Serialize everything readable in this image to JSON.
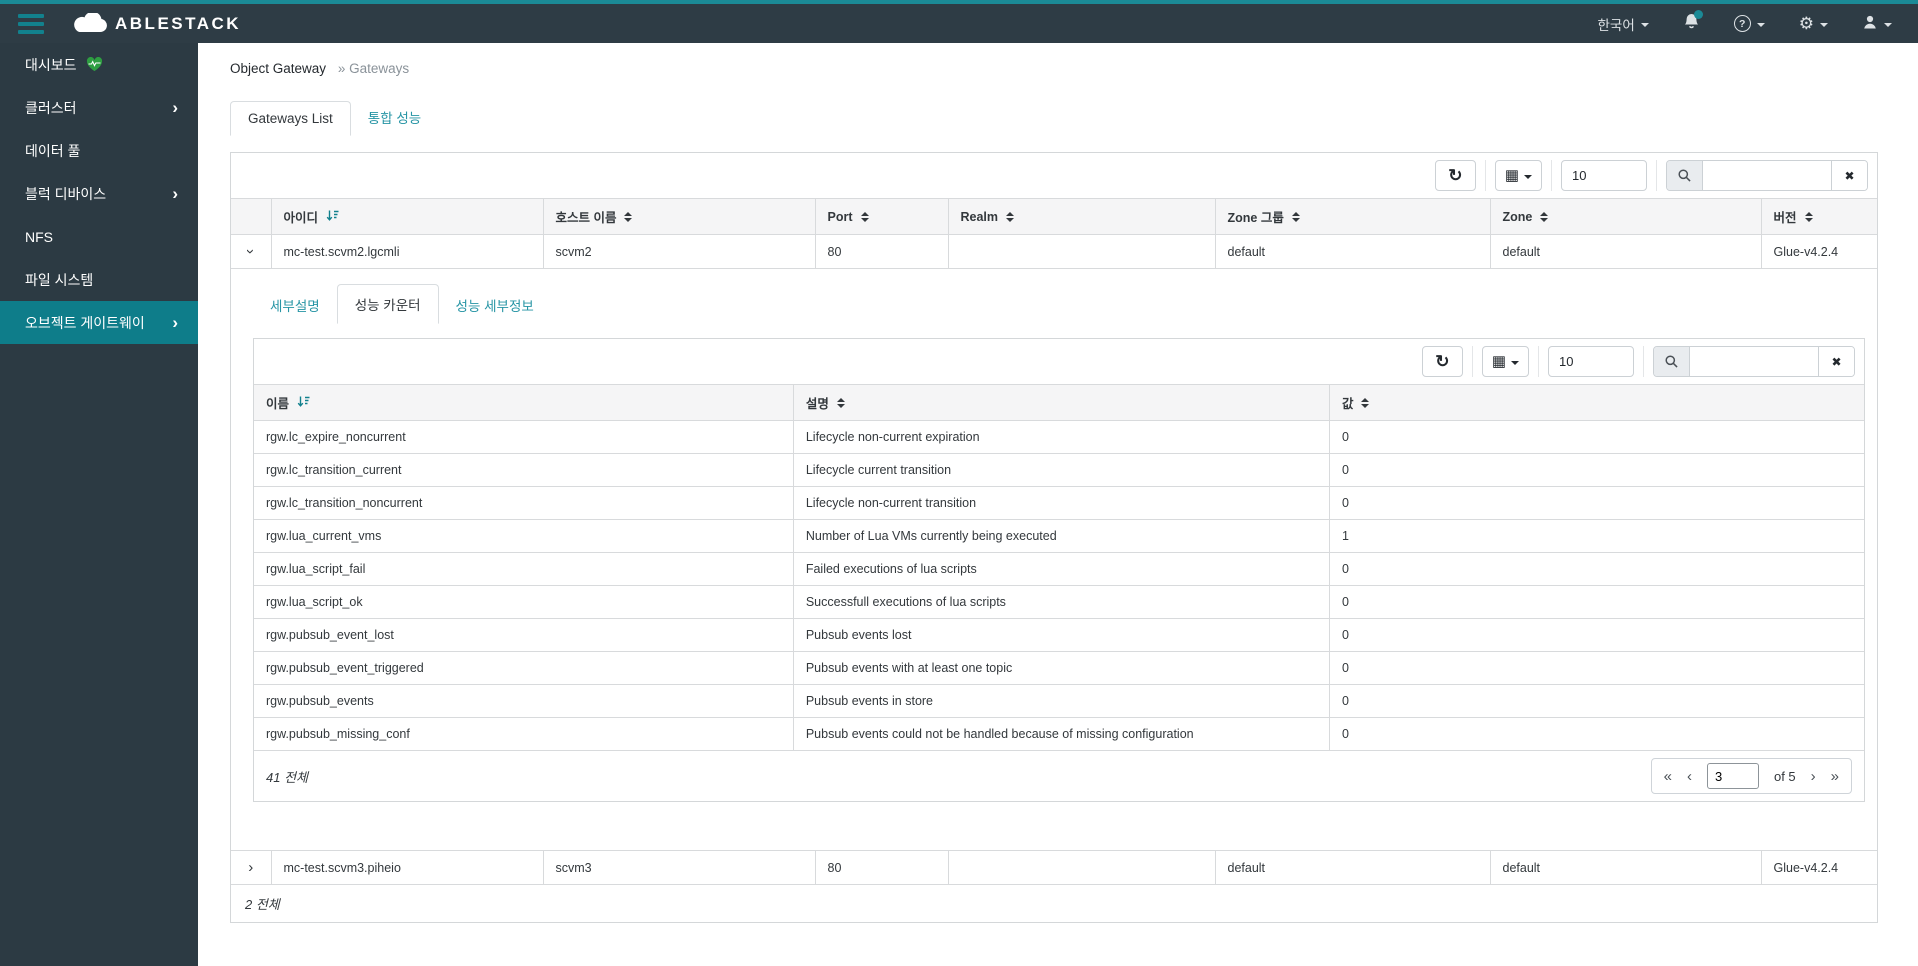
{
  "accent_colors": {
    "teal_strip": "#1b8a96",
    "active_nav": "#0e7d8a",
    "link_teal": "#2795a5",
    "sorted_header": "#11808d",
    "navbar_bg": "#2e3c45",
    "sidebar_bg": "#2c3a43"
  },
  "topbar": {
    "brand": "ABLESTACK",
    "language": "한국어",
    "help_glyph": "?"
  },
  "icons": {
    "refresh": "↻",
    "table_grid": "▦",
    "clear": "✖",
    "chevron": "›",
    "pg_first": "«",
    "pg_prev": "‹",
    "pg_next": "›",
    "pg_last": "»"
  },
  "sidebar": {
    "items": [
      {
        "label": "대시보드"
      },
      {
        "label": "클러스터"
      },
      {
        "label": "데이터 풀"
      },
      {
        "label": "블럭 디바이스"
      },
      {
        "label": "NFS"
      },
      {
        "label": "파일 시스템"
      },
      {
        "label": "오브젝트 게이트웨이"
      }
    ]
  },
  "breadcrumb": {
    "section": "Object Gateway",
    "rest": "» Gateways"
  },
  "tabs": {
    "gateways_list": "Gateways List",
    "overall_performance": "통합 성능"
  },
  "gateways_table": {
    "toolbar": {
      "page_size": "10",
      "search_value": ""
    },
    "columns": {
      "id": "아이디",
      "host": "호스트 이름",
      "port": "Port",
      "realm": "Realm",
      "zonegroup": "Zone 그룹",
      "zone": "Zone",
      "version": "버전"
    },
    "rows": [
      {
        "id": "mc-test.scvm2.lgcmli",
        "host": "scvm2",
        "port": "80",
        "realm": "",
        "zonegroup": "default",
        "zone": "default",
        "version": "Glue-v4.2.4"
      },
      {
        "id": "mc-test.scvm3.piheio",
        "host": "scvm3",
        "port": "80",
        "realm": "",
        "zonegroup": "default",
        "zone": "default",
        "version": "Glue-v4.2.4"
      }
    ],
    "footer_total": "2 전체"
  },
  "detail": {
    "tabs": {
      "details": "세부설명",
      "performance_counters": "성능 카운터",
      "performance_details": "성능 세부정보"
    },
    "counters_table": {
      "toolbar": {
        "page_size": "10",
        "search_value": ""
      },
      "columns": {
        "name": "이름",
        "description": "설명",
        "value": "값"
      },
      "rows": [
        {
          "name": "rgw.lc_expire_noncurrent",
          "description": "Lifecycle non-current expiration",
          "value": "0"
        },
        {
          "name": "rgw.lc_transition_current",
          "description": "Lifecycle current transition",
          "value": "0"
        },
        {
          "name": "rgw.lc_transition_noncurrent",
          "description": "Lifecycle non-current transition",
          "value": "0"
        },
        {
          "name": "rgw.lua_current_vms",
          "description": "Number of Lua VMs currently being executed",
          "value": "1"
        },
        {
          "name": "rgw.lua_script_fail",
          "description": "Failed executions of lua scripts",
          "value": "0"
        },
        {
          "name": "rgw.lua_script_ok",
          "description": "Successfull executions of lua scripts",
          "value": "0"
        },
        {
          "name": "rgw.pubsub_event_lost",
          "description": "Pubsub events lost",
          "value": "0"
        },
        {
          "name": "rgw.pubsub_event_triggered",
          "description": "Pubsub events with at least one topic",
          "value": "0"
        },
        {
          "name": "rgw.pubsub_events",
          "description": "Pubsub events in store",
          "value": "0"
        },
        {
          "name": "rgw.pubsub_missing_conf",
          "description": "Pubsub events could not be handled because of missing configuration",
          "value": "0"
        }
      ],
      "footer_total": "41 전체",
      "pagination": {
        "current_page": "3",
        "of_label": "of 5"
      }
    }
  }
}
